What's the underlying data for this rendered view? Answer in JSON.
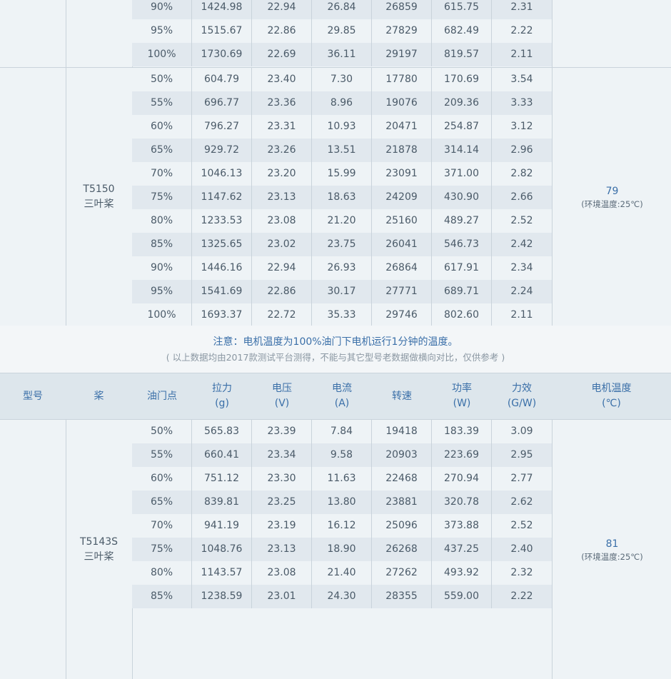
{
  "block1": {
    "rows": [
      [
        "90%",
        "1424.98",
        "22.94",
        "26.84",
        "26859",
        "615.75",
        "2.31"
      ],
      [
        "95%",
        "1515.67",
        "22.86",
        "29.85",
        "27829",
        "682.49",
        "2.22"
      ],
      [
        "100%",
        "1730.69",
        "22.69",
        "36.11",
        "29197",
        "819.57",
        "2.11"
      ]
    ]
  },
  "block2": {
    "model": "T5150",
    "prop": "三叶桨",
    "temp": "79",
    "temp_note": "(环境温度:25℃)",
    "rows": [
      [
        "50%",
        "604.79",
        "23.40",
        "7.30",
        "17780",
        "170.69",
        "3.54"
      ],
      [
        "55%",
        "696.77",
        "23.36",
        "8.96",
        "19076",
        "209.36",
        "3.33"
      ],
      [
        "60%",
        "796.27",
        "23.31",
        "10.93",
        "20471",
        "254.87",
        "3.12"
      ],
      [
        "65%",
        "929.72",
        "23.26",
        "13.51",
        "21878",
        "314.14",
        "2.96"
      ],
      [
        "70%",
        "1046.13",
        "23.20",
        "15.99",
        "23091",
        "371.00",
        "2.82"
      ],
      [
        "75%",
        "1147.62",
        "23.13",
        "18.63",
        "24209",
        "430.90",
        "2.66"
      ],
      [
        "80%",
        "1233.53",
        "23.08",
        "21.20",
        "25160",
        "489.27",
        "2.52"
      ],
      [
        "85%",
        "1325.65",
        "23.02",
        "23.75",
        "26041",
        "546.73",
        "2.42"
      ],
      [
        "90%",
        "1446.16",
        "22.94",
        "26.93",
        "26864",
        "617.91",
        "2.34"
      ],
      [
        "95%",
        "1541.69",
        "22.86",
        "30.17",
        "27771",
        "689.71",
        "2.24"
      ],
      [
        "100%",
        "1693.37",
        "22.72",
        "35.33",
        "29746",
        "802.60",
        "2.11"
      ]
    ]
  },
  "note": {
    "title": "注意：电机温度为100%油门下电机运行1分钟的温度。",
    "sub": "( 以上数据均由2017款测试平台测得，不能与其它型号老数据做横向对比，仅供参考 )"
  },
  "header": {
    "model": "型号",
    "prop": "桨",
    "throttle": "油门点",
    "thrust": "拉力",
    "thrust_unit": "(g)",
    "voltage": "电压",
    "voltage_unit": "(V)",
    "current": "电流",
    "current_unit": "(A)",
    "rpm": "转速",
    "power": "功率",
    "power_unit": "(W)",
    "efficiency": "力效",
    "efficiency_unit": "(G/W)",
    "temp": "电机温度",
    "temp_unit": "(℃)"
  },
  "block3": {
    "model": "T5143S",
    "prop": "三叶桨",
    "temp": "81",
    "temp_note": "(环境温度:25℃)",
    "rows": [
      [
        "50%",
        "565.83",
        "23.39",
        "7.84",
        "19418",
        "183.39",
        "3.09"
      ],
      [
        "55%",
        "660.41",
        "23.34",
        "9.58",
        "20903",
        "223.69",
        "2.95"
      ],
      [
        "60%",
        "751.12",
        "23.30",
        "11.63",
        "22468",
        "270.94",
        "2.77"
      ],
      [
        "65%",
        "839.81",
        "23.25",
        "13.80",
        "23881",
        "320.78",
        "2.62"
      ],
      [
        "70%",
        "941.19",
        "23.19",
        "16.12",
        "25096",
        "373.88",
        "2.52"
      ],
      [
        "75%",
        "1048.76",
        "23.13",
        "18.90",
        "26268",
        "437.25",
        "2.40"
      ],
      [
        "80%",
        "1143.57",
        "23.08",
        "21.40",
        "27262",
        "493.92",
        "2.32"
      ],
      [
        "85%",
        "1238.59",
        "23.01",
        "24.30",
        "28355",
        "559.00",
        "2.22"
      ]
    ]
  }
}
